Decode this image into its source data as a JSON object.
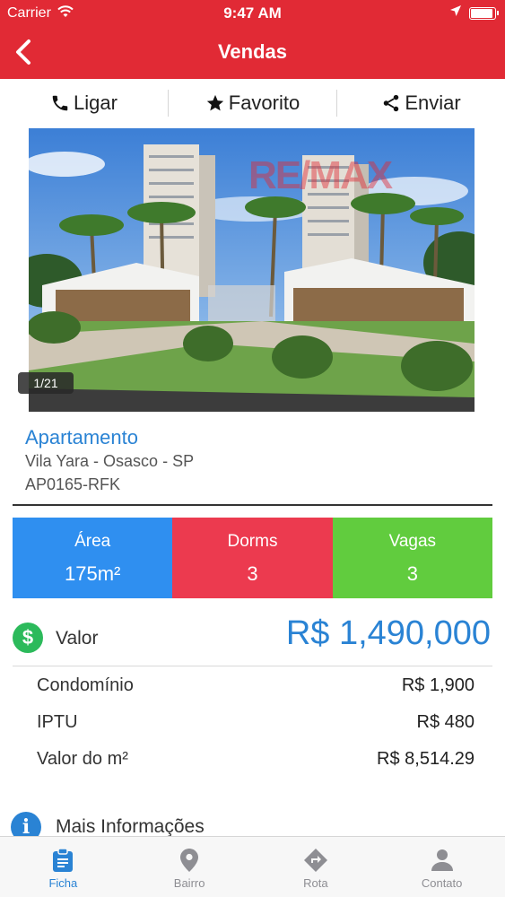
{
  "status_bar": {
    "carrier": "Carrier",
    "time": "9:47 AM"
  },
  "nav": {
    "title": "Vendas"
  },
  "actions": {
    "call": "Ligar",
    "favorite": "Favorito",
    "share": "Enviar"
  },
  "photo": {
    "counter": "1/21",
    "watermark": "RE/MAX"
  },
  "property": {
    "type": "Apartamento",
    "address": "Vila Yara - Osasco - SP",
    "code": "AP0165-RFK"
  },
  "stats": {
    "area": {
      "label": "Área",
      "value": "175m²"
    },
    "dorms": {
      "label": "Dorms",
      "value": "3"
    },
    "vagas": {
      "label": "Vagas",
      "value": "3"
    }
  },
  "price": {
    "label": "Valor",
    "amount": "R$ 1,490,000"
  },
  "details": [
    {
      "label": "Condomínio",
      "value": "R$ 1,900"
    },
    {
      "label": "IPTU",
      "value": "R$ 480"
    },
    {
      "label": "Valor do m²",
      "value": "R$ 8,514.29"
    }
  ],
  "more_info": {
    "label": "Mais Informações"
  },
  "tabs": [
    {
      "label": "Ficha",
      "icon": "clipboard-icon"
    },
    {
      "label": "Bairro",
      "icon": "map-pin-icon"
    },
    {
      "label": "Rota",
      "icon": "directions-icon"
    },
    {
      "label": "Contato",
      "icon": "person-icon"
    }
  ],
  "colors": {
    "brand_red": "#e12a35",
    "accent_blue": "#2a83d4",
    "area_blue": "#2f8ff0",
    "dorms_red": "#ec3a4f",
    "vagas_green": "#61cc3e"
  }
}
